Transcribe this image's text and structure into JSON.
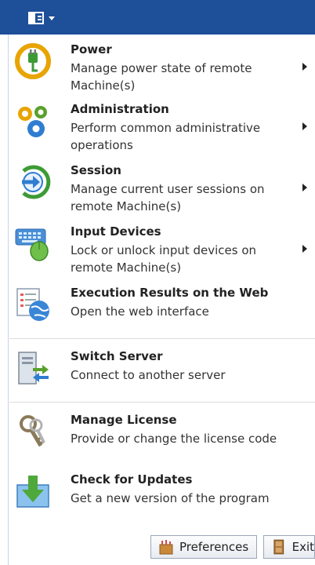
{
  "menu": {
    "items": [
      {
        "title": "Power",
        "desc": "Manage power state of remote Machine(s)",
        "icon": "power-plug-icon"
      },
      {
        "title": "Administration",
        "desc": "Perform common administrative operations",
        "icon": "gears-icon"
      },
      {
        "title": "Session",
        "desc": "Manage current user sessions on remote Machine(s)",
        "icon": "session-arrow-icon"
      },
      {
        "title": "Input Devices",
        "desc": "Lock or unlock input devices on remote Machine(s)",
        "icon": "keyboard-mouse-icon"
      },
      {
        "title": "Execution Results on the Web",
        "desc": "Open the web interface",
        "icon": "web-document-icon"
      },
      {
        "title": "Switch Server",
        "desc": "Connect to another server",
        "icon": "switch-server-icon"
      },
      {
        "title": "Manage License",
        "desc": "Provide or change the license code",
        "icon": "keys-icon"
      },
      {
        "title": "Check for Updates",
        "desc": "Get a new version of the program",
        "icon": "download-update-icon"
      }
    ]
  },
  "footer": {
    "preferences_label": "Preferences",
    "exit_label": "Exit"
  },
  "colors": {
    "title_bar": "#1e4f99",
    "accent_green": "#5aa02c",
    "accent_blue": "#2f7dd1"
  }
}
